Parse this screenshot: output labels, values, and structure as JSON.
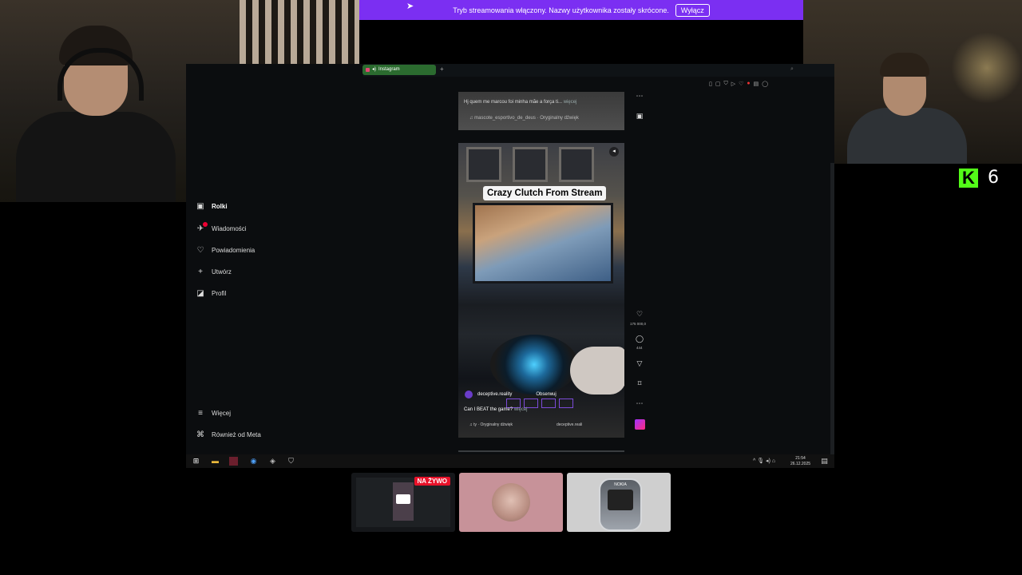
{
  "banner": {
    "text": "Tryb streamowania włączony. Nazwy użytkownika zostały skrócone.",
    "button": "Wyłącz"
  },
  "kick": {
    "logo_letter": "K",
    "count": "6"
  },
  "browser": {
    "tab_label": "Instagram",
    "add_tab": "+"
  },
  "sidebar": {
    "items": [
      {
        "label": "Rolki",
        "icon": "reels-icon"
      },
      {
        "label": "Wiadomości",
        "icon": "messages-icon"
      },
      {
        "label": "Powiadomienia",
        "icon": "heart-icon"
      },
      {
        "label": "Utwórz",
        "icon": "plus-icon"
      },
      {
        "label": "Profil",
        "icon": "profile-icon"
      }
    ],
    "more": "Więcej",
    "meta": "Również od Meta"
  },
  "reel1": {
    "caption": "Hj quem me marcou foi minha mãe a força ti...",
    "more": "więcej",
    "audio": "mascote_esportivo_de_deus · Oryginalny dźwięk"
  },
  "reel2": {
    "title": "Crazy Clutch From Stream",
    "account": "deceptive.reality",
    "follow": "Obserwuj",
    "caption": "Can I BEAT the game?",
    "more": "więcej",
    "audio": "ty · Oryginalny dźwięk",
    "audio_account": "deceptive.reali",
    "likes": "175 000,0",
    "comments": "444"
  },
  "taskbar": {
    "time": "21:54",
    "date": "26.12.2025"
  },
  "thumbnails": {
    "live_badge": "NA ŻYWO",
    "phone_brand": "NOKIA"
  }
}
